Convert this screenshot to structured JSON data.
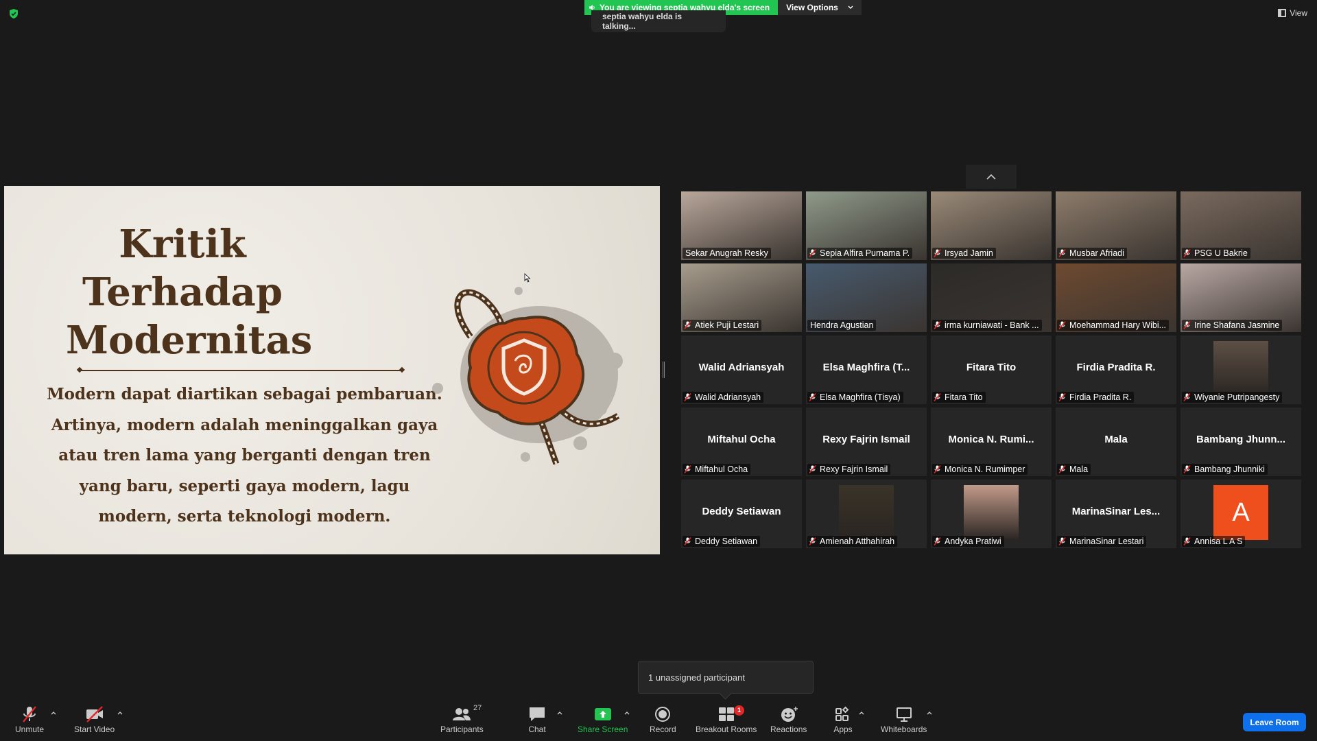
{
  "top": {
    "viewing_banner": "You are viewing septia wahyu elda's screen",
    "view_options": "View Options",
    "talking": "septia wahyu elda is talking...",
    "view": "View"
  },
  "slide": {
    "title_lines": [
      "Kritik",
      "Terhadap",
      "Modernitas"
    ],
    "body": "Modern dapat diartikan sebagai pembaruan. Artinya, modern adalah meninggalkan gaya atau tren lama yang berganti dengan tren yang baru, seperti gaya modern, lagu modern, serta teknologi modern."
  },
  "participants": [
    {
      "label": "Sekar Anugrah Resky",
      "muted": false,
      "video": true,
      "bg": "#b9a79b"
    },
    {
      "label": "Sepia Alfira Purnama P.",
      "muted": true,
      "video": true,
      "bg": "#8f9a8a"
    },
    {
      "label": "Irsyad Jamin",
      "muted": true,
      "video": true,
      "bg": "#9a8a78"
    },
    {
      "label": "Musbar Afriadi",
      "muted": true,
      "video": true,
      "bg": "#8d7c6b"
    },
    {
      "label": "PSG U Bakrie",
      "muted": true,
      "video": true,
      "bg": "#7a6a5e"
    },
    {
      "label": "Atiek Puji Lestari",
      "muted": true,
      "video": true,
      "bg": "#a79d8d"
    },
    {
      "label": "Hendra Agustian",
      "muted": false,
      "video": true,
      "bg": "#475a6e"
    },
    {
      "label": "irma kurniawati - Bank ...",
      "muted": true,
      "video": true,
      "bg": "#2c2a28"
    },
    {
      "label": "Moehammad Hary Wibi...",
      "muted": true,
      "video": true,
      "bg": "#6e4a30"
    },
    {
      "label": "Irine Shafana Jasmine",
      "muted": true,
      "video": true,
      "bg": "#b9a8a4"
    },
    {
      "label": "Walid Adriansyah",
      "muted": true,
      "big": "Walid Adriansyah"
    },
    {
      "label": "Elsa Maghfira (Tisya)",
      "muted": true,
      "big": "Elsa Maghfira (T..."
    },
    {
      "label": "Fitara Tito",
      "muted": true,
      "big": "Fitara Tito"
    },
    {
      "label": "Firdia Pradita R.",
      "muted": true,
      "big": "Firdia Pradita R."
    },
    {
      "label": "Wiyanie Putripangesty",
      "muted": true,
      "thumb": "#5d4f45"
    },
    {
      "label": "Miftahul Ocha",
      "muted": true,
      "big": "Miftahul Ocha"
    },
    {
      "label": "Rexy Fajrin Ismail",
      "muted": true,
      "big": "Rexy Fajrin Ismail"
    },
    {
      "label": "Monica N. Rumimper",
      "muted": true,
      "big": "Monica N. Rumi..."
    },
    {
      "label": "Mala",
      "muted": true,
      "big": "Mala"
    },
    {
      "label": "Bambang Jhunniki",
      "muted": true,
      "big": "Bambang  Jhunn..."
    },
    {
      "label": "Deddy Setiawan",
      "muted": true,
      "big": "Deddy Setiawan"
    },
    {
      "label": "Amienah Atthahirah",
      "muted": true,
      "thumb": "#3a3328"
    },
    {
      "label": "Andyka Pratiwi",
      "muted": true,
      "thumb": "#c29a8a"
    },
    {
      "label": "MarinaSinar Lestari",
      "muted": true,
      "big": "MarinaSinar  Les..."
    },
    {
      "label": "Annisa L A S",
      "muted": true,
      "letter": "A",
      "letter_bg": "#ef4e1d"
    }
  ],
  "popup": "1 unassigned participant",
  "toolbar": {
    "unmute": "Unmute",
    "start_video": "Start Video",
    "participants": "Participants",
    "participants_count": "27",
    "chat": "Chat",
    "share": "Share Screen",
    "record": "Record",
    "breakout": "Breakout Rooms",
    "breakout_badge": "1",
    "reactions": "Reactions",
    "apps": "Apps",
    "whiteboards": "Whiteboards",
    "leave": "Leave Room"
  },
  "colors": {
    "accent_green": "#23c552",
    "leave_blue": "#0e71eb",
    "slide_text": "#4d331b",
    "seal": "#c44a1b"
  }
}
